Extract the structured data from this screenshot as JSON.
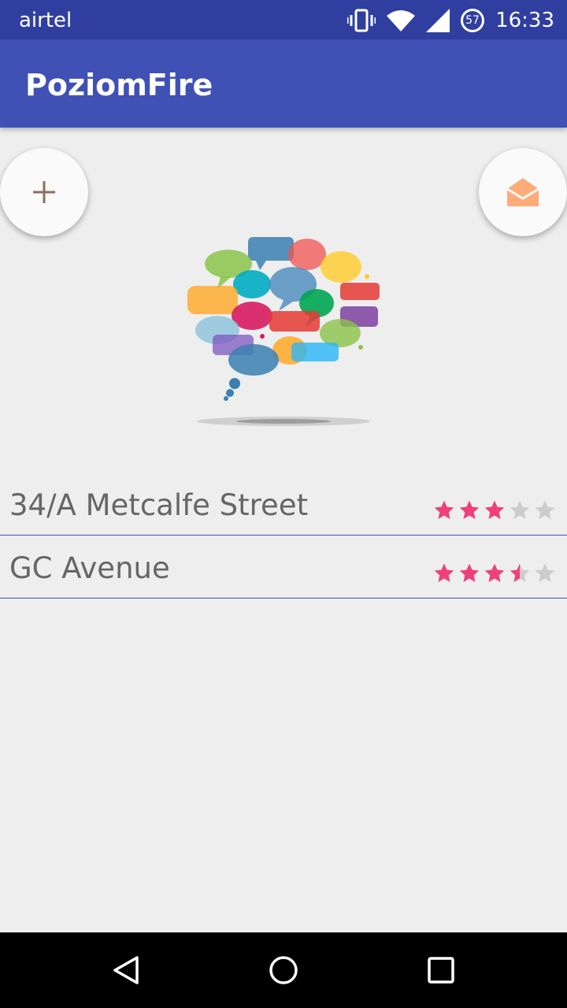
{
  "status_bar": {
    "carrier": "airtel",
    "battery": "57",
    "time": "16:33",
    "icons": [
      "vibrate-icon",
      "wifi-icon",
      "signal-icon",
      "battery-icon"
    ]
  },
  "app": {
    "title": "PoziomFire"
  },
  "actions": {
    "add_icon": "plus-icon",
    "mail_icon": "open-mail-icon"
  },
  "colors": {
    "primary": "#3f51b5",
    "primary_dark": "#303f9f",
    "star_filled": "#ef3f7c",
    "star_empty": "#cccccc",
    "mail_icon": "#ffab7a"
  },
  "places": [
    {
      "name": "34/A Metcalfe Street",
      "rating": 3,
      "max_rating": 5
    },
    {
      "name": "GC Avenue",
      "rating": 3.5,
      "max_rating": 5
    }
  ],
  "nav": [
    "back-icon",
    "home-icon",
    "recents-icon"
  ]
}
